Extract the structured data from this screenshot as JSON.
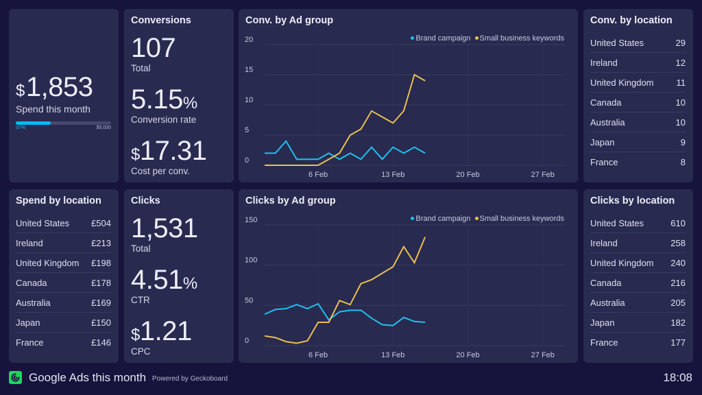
{
  "colors": {
    "background": "#16143d",
    "card": "#292a50",
    "brand_series": "#1fc1ef",
    "small_business_series": "#e8c14f",
    "progress_fill": "#00bcf2",
    "logo": "#22d35a"
  },
  "spend": {
    "currency": "$",
    "value": "1,853",
    "label": "Spend this month",
    "progress_percent": 37,
    "progress_label": "37%",
    "goal_label": "$5,000"
  },
  "conversions": {
    "title": "Conversions",
    "total": "107",
    "total_label": "Total",
    "rate": "5.15",
    "rate_unit": "%",
    "rate_label": "Conversion rate",
    "cost_currency": "$",
    "cost": "17.31",
    "cost_label": "Cost per conv."
  },
  "clicks": {
    "title": "Clicks",
    "total": "1,531",
    "total_label": "Total",
    "ctr": "4.51",
    "ctr_unit": "%",
    "ctr_label": "CTR",
    "cpc_currency": "$",
    "cpc": "1.21",
    "cpc_label": "CPC"
  },
  "spend_by_location": {
    "title": "Spend by location",
    "rows": [
      {
        "country": "United States",
        "value": "£504"
      },
      {
        "country": "Ireland",
        "value": "£213"
      },
      {
        "country": "United Kingdom",
        "value": "£198"
      },
      {
        "country": "Canada",
        "value": "£178"
      },
      {
        "country": "Australia",
        "value": "£169"
      },
      {
        "country": "Japan",
        "value": "£150"
      },
      {
        "country": "France",
        "value": "£146"
      }
    ]
  },
  "conv_by_location": {
    "title": "Conv. by location",
    "rows": [
      {
        "country": "United States",
        "value": "29"
      },
      {
        "country": "Ireland",
        "value": "12"
      },
      {
        "country": "United Kingdom",
        "value": "11"
      },
      {
        "country": "Canada",
        "value": "10"
      },
      {
        "country": "Australia",
        "value": "10"
      },
      {
        "country": "Japan",
        "value": "9"
      },
      {
        "country": "France",
        "value": "8"
      }
    ]
  },
  "clicks_by_location": {
    "title": "Clicks by location",
    "rows": [
      {
        "country": "United States",
        "value": "610"
      },
      {
        "country": "Ireland",
        "value": "258"
      },
      {
        "country": "United Kingdom",
        "value": "240"
      },
      {
        "country": "Canada",
        "value": "216"
      },
      {
        "country": "Australia",
        "value": "205"
      },
      {
        "country": "Japan",
        "value": "182"
      },
      {
        "country": "France",
        "value": "177"
      }
    ]
  },
  "chart_data": [
    {
      "type": "line",
      "title": "Conv. by Ad group",
      "x_domain_days": [
        1,
        29
      ],
      "x_ticks": [
        {
          "day": 6,
          "label": "6 Feb"
        },
        {
          "day": 13,
          "label": "13 Feb"
        },
        {
          "day": 20,
          "label": "20 Feb"
        },
        {
          "day": 27,
          "label": "27 Feb"
        }
      ],
      "ylim": [
        0,
        20
      ],
      "y_ticks": [
        0,
        5,
        10,
        15,
        20
      ],
      "grid": true,
      "legend_position": "top-right",
      "x_days": [
        1,
        2,
        3,
        4,
        5,
        6,
        7,
        8,
        9,
        10,
        11,
        12,
        13,
        14,
        15,
        16
      ],
      "series": [
        {
          "name": "Brand campaign",
          "color": "#1fc1ef",
          "values": [
            2,
            2,
            4,
            1,
            1,
            1,
            2,
            1,
            2,
            1,
            3,
            1,
            3,
            2,
            3,
            2
          ]
        },
        {
          "name": "Small business keywords",
          "color": "#e8c14f",
          "values": [
            0,
            0,
            0,
            0,
            0,
            0,
            1,
            2,
            5,
            6,
            9,
            8,
            7,
            9,
            15,
            14
          ]
        }
      ]
    },
    {
      "type": "line",
      "title": "Clicks by Ad group",
      "x_domain_days": [
        1,
        29
      ],
      "x_ticks": [
        {
          "day": 6,
          "label": "6 Feb"
        },
        {
          "day": 13,
          "label": "13 Feb"
        },
        {
          "day": 20,
          "label": "20 Feb"
        },
        {
          "day": 27,
          "label": "27 Feb"
        }
      ],
      "ylim": [
        0,
        150
      ],
      "y_ticks": [
        0,
        50,
        100,
        150
      ],
      "grid": true,
      "legend_position": "top-right",
      "x_days": [
        1,
        2,
        3,
        4,
        5,
        6,
        7,
        8,
        9,
        10,
        11,
        12,
        13,
        14,
        15,
        16
      ],
      "series": [
        {
          "name": "Brand campaign",
          "color": "#1fc1ef",
          "values": [
            39,
            45,
            46,
            51,
            46,
            52,
            32,
            42,
            44,
            44,
            34,
            26,
            25,
            35,
            30,
            29
          ]
        },
        {
          "name": "Small business keywords",
          "color": "#e8c14f",
          "values": [
            12,
            10,
            5,
            3,
            6,
            29,
            29,
            56,
            51,
            77,
            82,
            90,
            98,
            123,
            103,
            135
          ]
        }
      ]
    }
  ],
  "footer": {
    "title": "Google Ads this month",
    "powered_by": "Powered by Geckoboard",
    "time": "18:08"
  }
}
